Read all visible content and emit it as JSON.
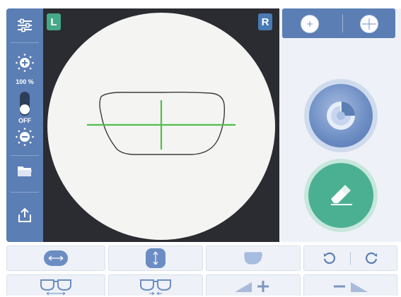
{
  "viewport": {
    "left_eye_label": "L",
    "right_eye_label": "R"
  },
  "sidebar": {
    "brightness_percent": "100 %",
    "toggle_state": "OFF"
  },
  "colors": {
    "sidebar_blue": "#5b7eb4",
    "viewport_dark": "#2a2c31",
    "lens_bg": "#f4f4f3",
    "crosshair_green": "#4fbf4a",
    "left_badge": "#45a887",
    "right_badge": "#4a7ab3",
    "erase_teal": "#4bb092"
  },
  "icons": {
    "sidebar": [
      "sliders-icon",
      "brightness-up-icon",
      "brightness-down-icon",
      "folder-icon",
      "upload-icon"
    ],
    "right_panel": [
      "small-cross-icon",
      "large-cross-icon",
      "measure-lens-icon",
      "eraser-icon"
    ],
    "toolbar": [
      "horizontal-resize-icon",
      "vertical-resize-icon",
      "lens-shape-icon",
      "rotate-left-icon",
      "rotate-right-icon",
      "glasses-width-increase-icon",
      "glasses-width-decrease-icon",
      "zoom-in-icon",
      "zoom-out-icon"
    ]
  }
}
